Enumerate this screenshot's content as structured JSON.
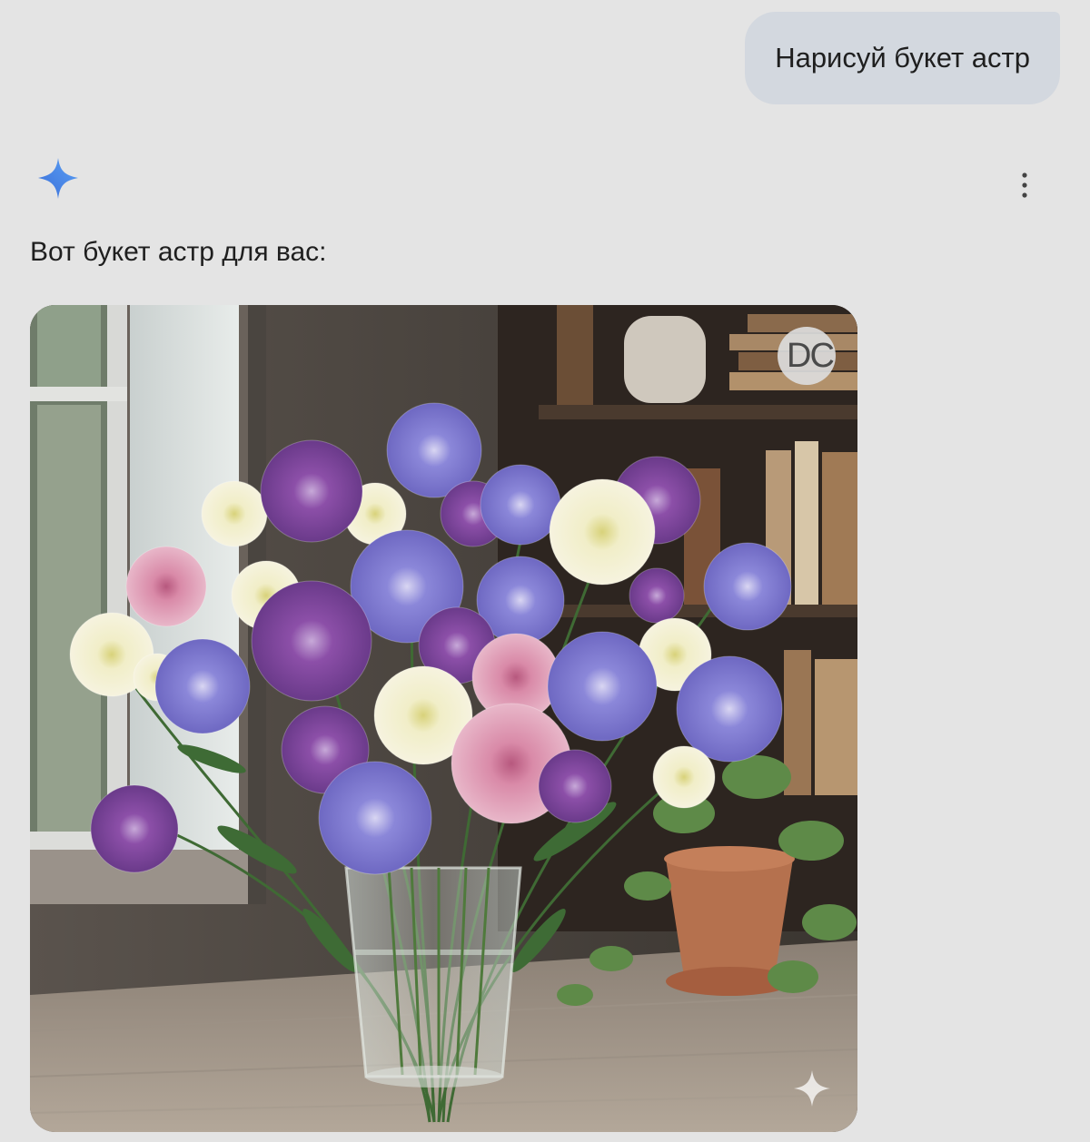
{
  "user_message": {
    "text": "Нарисуй букет астр"
  },
  "assistant": {
    "logo_icon": "gemini-sparkle-icon",
    "more_icon": "more-vertical-icon",
    "response_text": "Вот букет астр для вас:",
    "image": {
      "subject": "aster bouquet in glass vase",
      "badge_text": "DC",
      "watermark_icon": "sparkle-icon"
    }
  },
  "colors": {
    "background": "#e4e4e4",
    "user_bubble": "#d3d8df",
    "logo_blue": "#4a8cf0"
  }
}
